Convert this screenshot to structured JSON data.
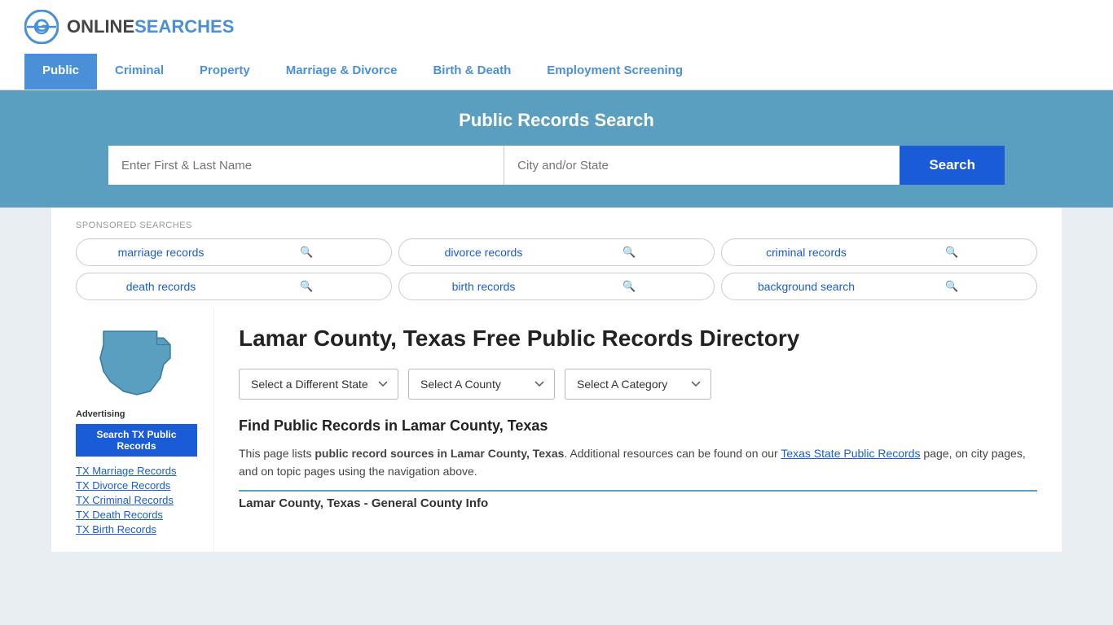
{
  "site": {
    "logo_online": "ONLINE",
    "logo_searches": "SEARCHES"
  },
  "nav": {
    "items": [
      {
        "label": "Public",
        "active": true
      },
      {
        "label": "Criminal",
        "active": false
      },
      {
        "label": "Property",
        "active": false
      },
      {
        "label": "Marriage & Divorce",
        "active": false
      },
      {
        "label": "Birth & Death",
        "active": false
      },
      {
        "label": "Employment Screening",
        "active": false
      }
    ]
  },
  "hero": {
    "title": "Public Records Search",
    "name_placeholder": "Enter First & Last Name",
    "location_placeholder": "City and/or State",
    "search_button": "Search"
  },
  "sponsored": {
    "label": "SPONSORED SEARCHES",
    "tags": [
      "marriage records",
      "divorce records",
      "criminal records",
      "death records",
      "birth records",
      "background search"
    ]
  },
  "page": {
    "title": "Lamar County, Texas Free Public Records Directory",
    "dropdown_state": "Select a Different State",
    "dropdown_county": "Select A County",
    "dropdown_category": "Select A Category",
    "find_title": "Find Public Records in Lamar County, Texas",
    "find_text_1": "This page lists ",
    "find_bold": "public record sources in Lamar County, Texas",
    "find_text_2": ". Additional resources can be found on our ",
    "find_link": "Texas State Public Records",
    "find_text_3": " page, on city pages, and on topic pages using the navigation above.",
    "section_header": "Lamar County, Texas - General County Info"
  },
  "sidebar": {
    "ad_label": "Advertising",
    "ad_button": "Search TX Public Records",
    "links": [
      "TX Marriage Records",
      "TX Divorce Records",
      "TX Criminal Records",
      "TX Death Records",
      "TX Birth Records"
    ]
  },
  "colors": {
    "blue": "#1a5cd8",
    "teal": "#5a9fc0",
    "nav_active": "#4a90d9"
  }
}
